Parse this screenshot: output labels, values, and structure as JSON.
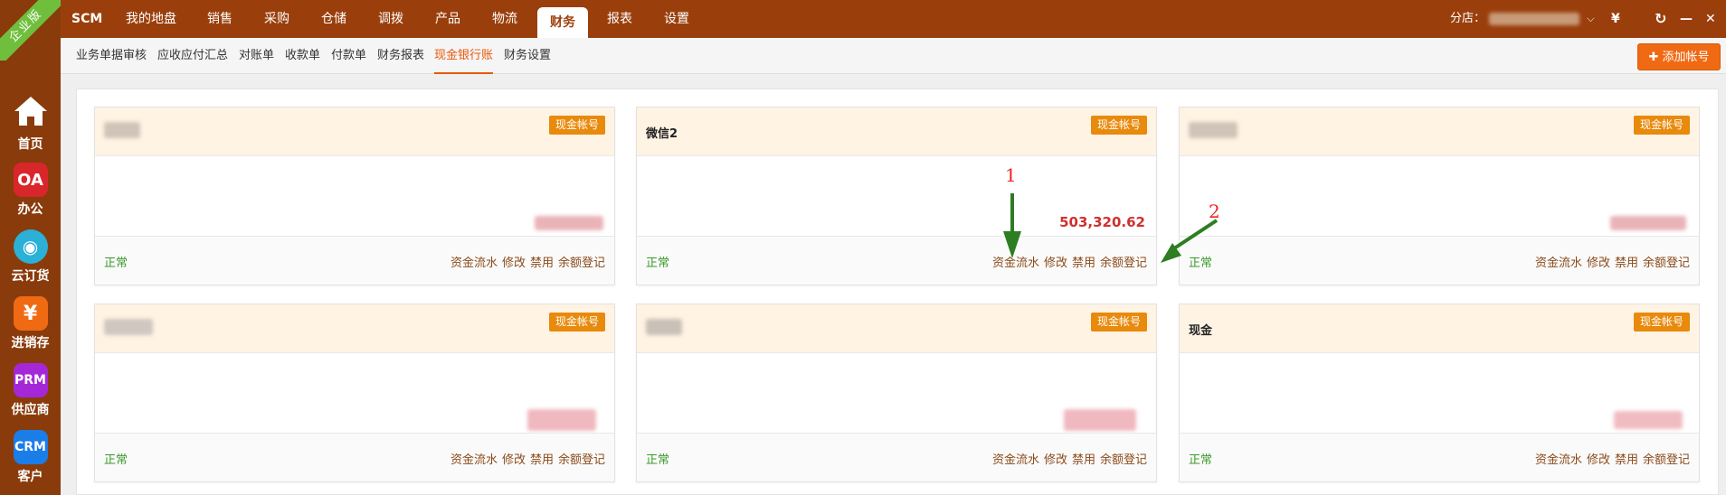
{
  "sidebar": {
    "edition": "企业版",
    "items": [
      {
        "label": "首页",
        "icon": "home-icon"
      },
      {
        "label": "办公",
        "icon_text": "OA",
        "color": "#d8262b"
      },
      {
        "label": "云订货",
        "icon_text": "◉",
        "color": "#2bb0d8"
      },
      {
        "label": "进销存",
        "icon_text": "¥",
        "color": "#ef6a13"
      },
      {
        "label": "供应商",
        "icon_text": "PRM",
        "color": "#a428d8"
      },
      {
        "label": "客户",
        "icon_text": "CRM",
        "color": "#1b7de8"
      }
    ]
  },
  "topnav": {
    "tabs": [
      "SCM",
      "我的地盘",
      "销售",
      "采购",
      "仓储",
      "调拨",
      "产品",
      "物流",
      "财务",
      "报表",
      "设置"
    ],
    "active": "财务",
    "store_label": "分店：",
    "icons": {
      "currency": "¥",
      "refresh": "↻",
      "minimize": "—",
      "close": "✕"
    }
  },
  "subnav": {
    "items": [
      "业务单据审核",
      "应收应付汇总",
      "对账单",
      "收款单",
      "付款单",
      "财务报表",
      "现金银行账",
      "财务设置"
    ],
    "active": "现金银行账",
    "add_button": "添加帐号"
  },
  "cards": [
    {
      "name": "",
      "badge": "现金帐号",
      "amount": "",
      "status": "正常",
      "actions": [
        "资金流水",
        "修改",
        "禁用",
        "余额登记"
      ]
    },
    {
      "name": "微信2",
      "badge": "现金帐号",
      "amount": "503,320.62",
      "status": "正常",
      "actions": [
        "资金流水",
        "修改",
        "禁用",
        "余额登记"
      ]
    },
    {
      "name": "",
      "badge": "现金帐号",
      "amount": "",
      "status": "正常",
      "actions": [
        "资金流水",
        "修改",
        "禁用",
        "余额登记"
      ]
    },
    {
      "name": "",
      "badge": "现金帐号",
      "amount": "",
      "status": "正常",
      "actions": [
        "资金流水",
        "修改",
        "禁用",
        "余额登记"
      ]
    },
    {
      "name": "",
      "badge": "现金帐号",
      "amount": "",
      "status": "正常",
      "actions": [
        "资金流水",
        "修改",
        "禁用",
        "余额登记"
      ]
    },
    {
      "name": "现金",
      "badge": "现金帐号",
      "amount": "",
      "status": "正常",
      "actions": [
        "资金流水",
        "修改",
        "禁用",
        "余额登记"
      ]
    }
  ],
  "annotations": {
    "arrow1": "1",
    "arrow2": "2",
    "color": "#2e7d22"
  }
}
